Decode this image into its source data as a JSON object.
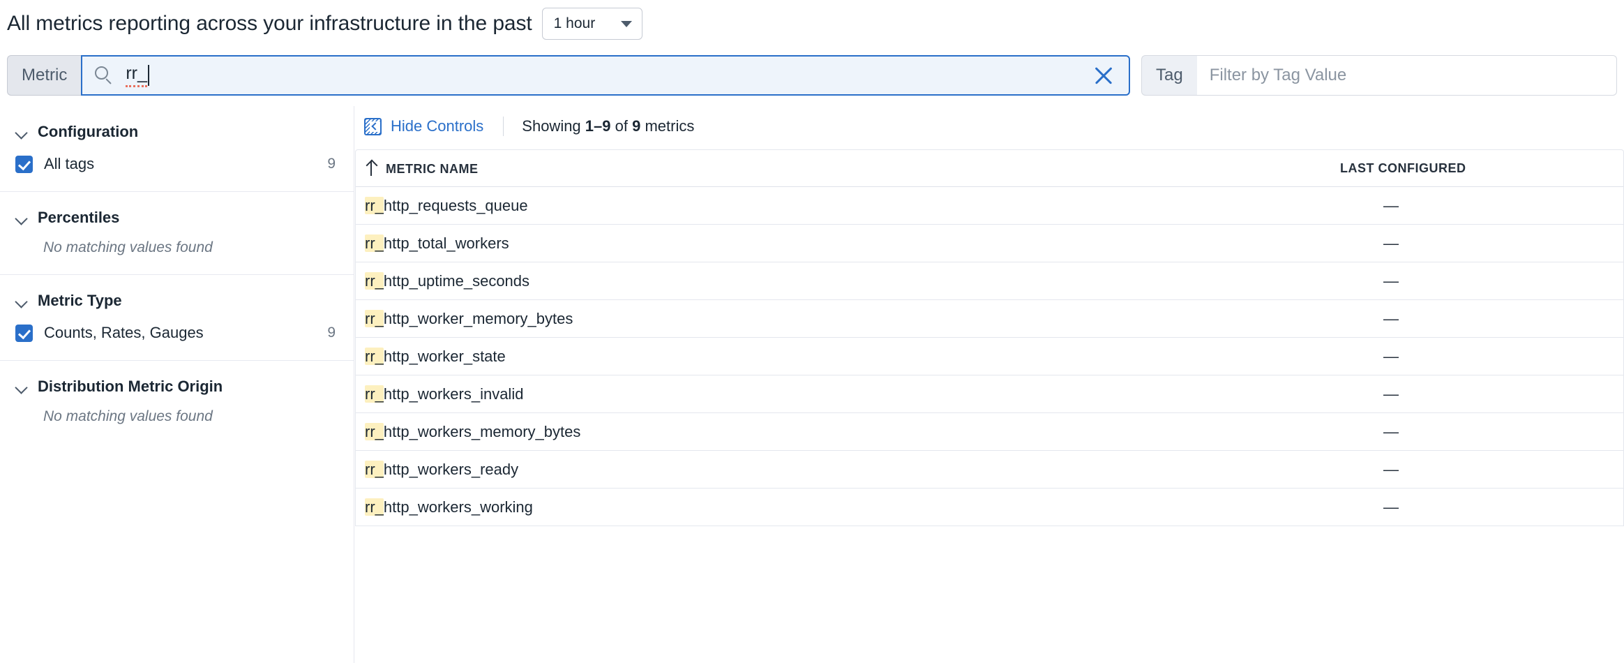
{
  "header": {
    "title": "All metrics reporting across your infrastructure in the past",
    "timerange_value": "1 hour"
  },
  "search": {
    "metric_prefix_label": "Metric",
    "metric_value": "rr_",
    "metric_clear_icon": "close-icon",
    "metric_search_icon": "search-icon",
    "tag_prefix_label": "Tag",
    "tag_placeholder": "Filter by Tag Value"
  },
  "sidebar": {
    "sections": [
      {
        "title": "Configuration",
        "chevron_icon": "chevron-down-icon",
        "option_label": "All tags",
        "option_count": "9",
        "checked": true,
        "empty_text": null
      },
      {
        "title": "Percentiles",
        "chevron_icon": "chevron-down-icon",
        "option_label": null,
        "option_count": null,
        "checked": false,
        "empty_text": "No matching values found"
      },
      {
        "title": "Metric Type",
        "chevron_icon": "chevron-down-icon",
        "option_label": "Counts, Rates, Gauges",
        "option_count": "9",
        "checked": true,
        "empty_text": null
      },
      {
        "title": "Distribution Metric Origin",
        "chevron_icon": "chevron-down-icon",
        "option_label": null,
        "option_count": null,
        "checked": false,
        "empty_text": "No matching values found"
      }
    ]
  },
  "controls": {
    "hide_controls_label": "Hide Controls",
    "hide_controls_icon": "collapse-panel-icon",
    "showing_prefix": "Showing ",
    "showing_range": "1–9",
    "showing_middle": " of ",
    "showing_total": "9",
    "showing_suffix": " metrics"
  },
  "table": {
    "sort_icon": "sort-ascending-icon",
    "columns": [
      "METRIC NAME",
      "LAST CONFIGURED"
    ],
    "highlight_prefix": "rr_",
    "highlight_color": "#fdf0bf",
    "rows": [
      {
        "name": "rr_http_requests_queue",
        "highlight": "rr_",
        "rest": "http_requests_queue",
        "last_configured": "—"
      },
      {
        "name": "rr_http_total_workers",
        "highlight": "rr_",
        "rest": "http_total_workers",
        "last_configured": "—"
      },
      {
        "name": "rr_http_uptime_seconds",
        "highlight": "rr_",
        "rest": "http_uptime_seconds",
        "last_configured": "—"
      },
      {
        "name": "rr_http_worker_memory_bytes",
        "highlight": "rr_",
        "rest": "http_worker_memory_bytes",
        "last_configured": "—"
      },
      {
        "name": "rr_http_worker_state",
        "highlight": "rr_",
        "rest": "http_worker_state",
        "last_configured": "—"
      },
      {
        "name": "rr_http_workers_invalid",
        "highlight": "rr_",
        "rest": "http_workers_invalid",
        "last_configured": "—"
      },
      {
        "name": "rr_http_workers_memory_bytes",
        "highlight": "rr_",
        "rest": "http_workers_memory_bytes",
        "last_configured": "—"
      },
      {
        "name": "rr_http_workers_ready",
        "highlight": "rr_",
        "rest": "http_workers_ready",
        "last_configured": "—"
      },
      {
        "name": "rr_http_workers_working",
        "highlight": "rr_",
        "rest": "http_workers_working",
        "last_configured": "—"
      }
    ]
  },
  "colors": {
    "accent_blue": "#2a6fc9",
    "text_dark": "#1b2733",
    "text_muted": "#6b7683",
    "highlight_yellow": "#fdf0bf",
    "focus_field_bg": "#eef4fb"
  }
}
